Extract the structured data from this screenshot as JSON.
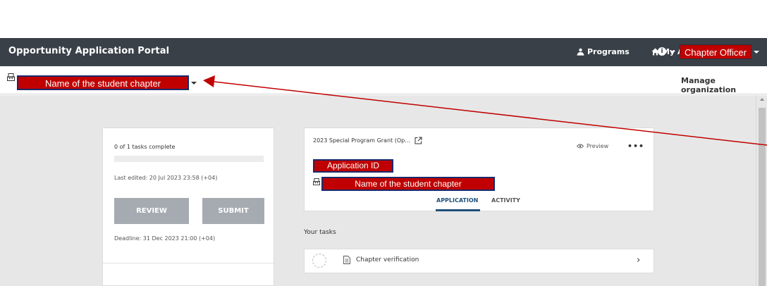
{
  "navbar": {
    "title": "Opportunity Application Portal",
    "programs_label": "Programs",
    "my_applications_label": "My Applications",
    "info_icon": "info-icon",
    "user_role_label": "Chapter Officer"
  },
  "orgbar": {
    "org_name": "Name of the student chapter",
    "manage_label": "Manage organization"
  },
  "summary_card": {
    "tasks_complete": "0 of 1 tasks complete",
    "progress": 0,
    "last_edited": "Last edited: 20 Jul 2023 23:58 (+04)",
    "review_label": "REVIEW",
    "submit_label": "SUBMIT",
    "deadline": "Deadline: 31 Dec 2023 21:00 (+04)"
  },
  "application_card": {
    "title": "2023 Special Program Grant (Op...",
    "preview_label": "Preview",
    "more_label": "•••",
    "application_id_label": "Application ID",
    "org_name": "Name of the student chapter",
    "tabs": [
      {
        "label": "APPLICATION",
        "active": true
      },
      {
        "label": "ACTIVITY",
        "active": false
      }
    ]
  },
  "tasks": {
    "heading": "Your tasks",
    "items": [
      {
        "label": "Chapter verification"
      }
    ]
  },
  "colors": {
    "navbar": "#3a4048",
    "highlight": "#c00000",
    "highlight_border": "#1a2a6c",
    "content_bg": "#e7e7e7",
    "button_disabled": "#a5abb1",
    "tab_active": "#1f4f7a"
  }
}
